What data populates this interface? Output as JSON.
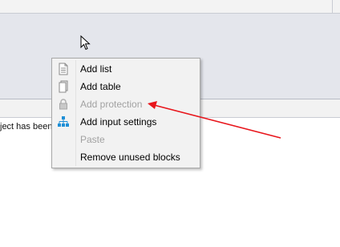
{
  "log": {
    "visible_text": "ject has been"
  },
  "context_menu": {
    "items": [
      {
        "label": "Add list",
        "icon": "list-document-icon",
        "enabled": true
      },
      {
        "label": "Add table",
        "icon": "table-document-icon",
        "enabled": true
      },
      {
        "label": "Add protection",
        "icon": "lock-icon",
        "enabled": false
      },
      {
        "label": "Add input settings",
        "icon": "hierarchy-icon",
        "enabled": true
      },
      {
        "label": "Paste",
        "icon": "",
        "enabled": false
      },
      {
        "label": "Remove unused blocks",
        "icon": "",
        "enabled": true
      }
    ]
  },
  "colors": {
    "work_area": "#e4e6ec",
    "menu_background": "#f2f2f2",
    "disabled_text": "#a2a2a2",
    "annotation_arrow": "#e8151b",
    "hierarchy_icon": "#1f8fd6"
  }
}
